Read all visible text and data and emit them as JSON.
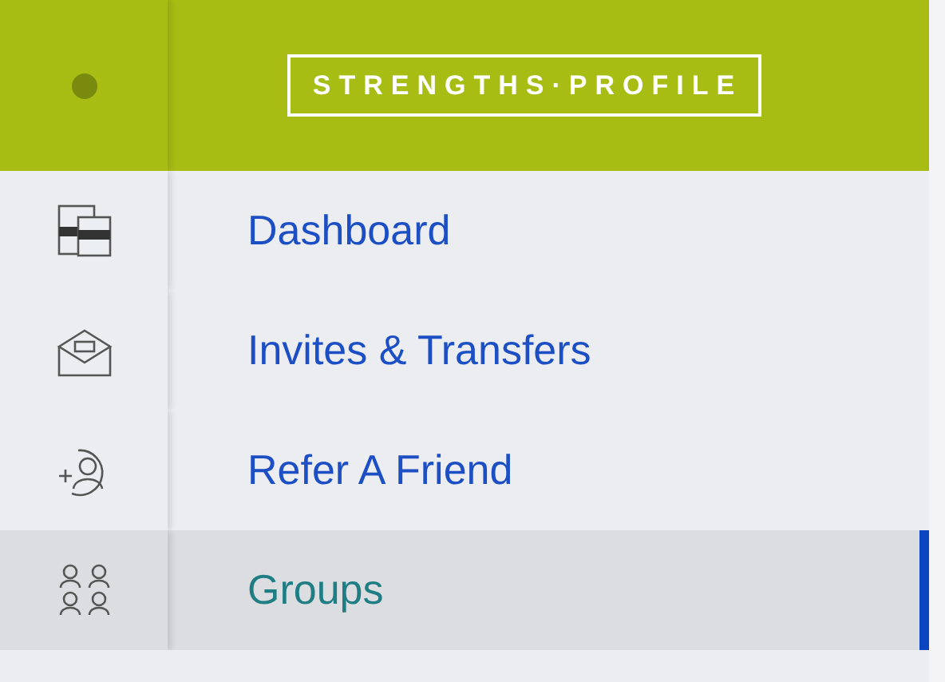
{
  "header": {
    "logo": "STRENGTHS·PROFILE"
  },
  "nav": [
    {
      "label": "Dashboard",
      "selected": false
    },
    {
      "label": "Invites & Transfers",
      "selected": false
    },
    {
      "label": "Refer A Friend",
      "selected": false
    },
    {
      "label": "Groups",
      "selected": true
    }
  ]
}
